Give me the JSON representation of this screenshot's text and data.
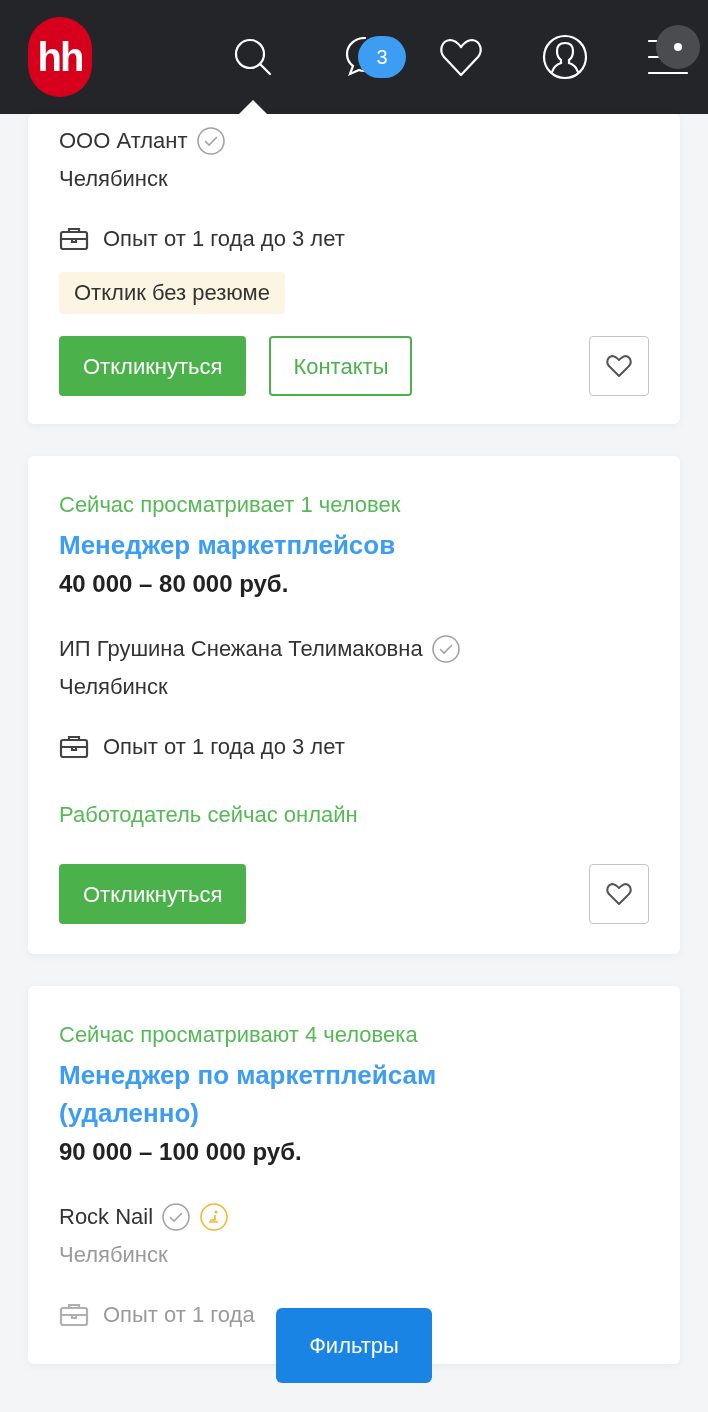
{
  "header": {
    "logo": "hh",
    "nav": [
      {
        "kind": "search",
        "selected": true
      },
      {
        "kind": "chat",
        "selected": false,
        "badge": "3"
      },
      {
        "kind": "favorites",
        "selected": false
      },
      {
        "kind": "profile",
        "selected": false
      },
      {
        "kind": "menu",
        "selected": false,
        "notice": true
      }
    ]
  },
  "vacancies": [
    {
      "company": "ООО Атлант",
      "verified": true,
      "accredited": false,
      "city": "Челябинск",
      "experience": "Опыт от 1 года до 3 лет",
      "faded": false,
      "tag": "Отклик без резюме",
      "buttons": [
        {
          "kind": "respond",
          "label": "Откликнуться"
        },
        {
          "kind": "contacts",
          "label": "Контакты"
        }
      ]
    },
    {
      "viewers": "Сейчас просматривает 1 человек",
      "title": "Менеджер маркетплейсов",
      "salary": "40 000 – 80 000 руб.",
      "company": "ИП Грушина Снежана Телимаковна",
      "verified": true,
      "accredited": false,
      "city": "Челябинск",
      "experience": "Опыт от 1 года до 3 лет",
      "faded": false,
      "employer_status": "Работодатель сейчас онлайн",
      "buttons": [
        {
          "kind": "respond",
          "label": "Откликнуться"
        }
      ]
    },
    {
      "viewers": "Сейчас просматривают 4 человека",
      "title": "Менеджер по маркетплейсам (удаленно)",
      "salary": "90 000 – 100 000 руб.",
      "company": "Rock Nail",
      "verified": true,
      "accredited": true,
      "city": "Челябинск",
      "experience": "Опыт от 1 года",
      "faded": true
    }
  ],
  "filters_button": "Фильтры"
}
